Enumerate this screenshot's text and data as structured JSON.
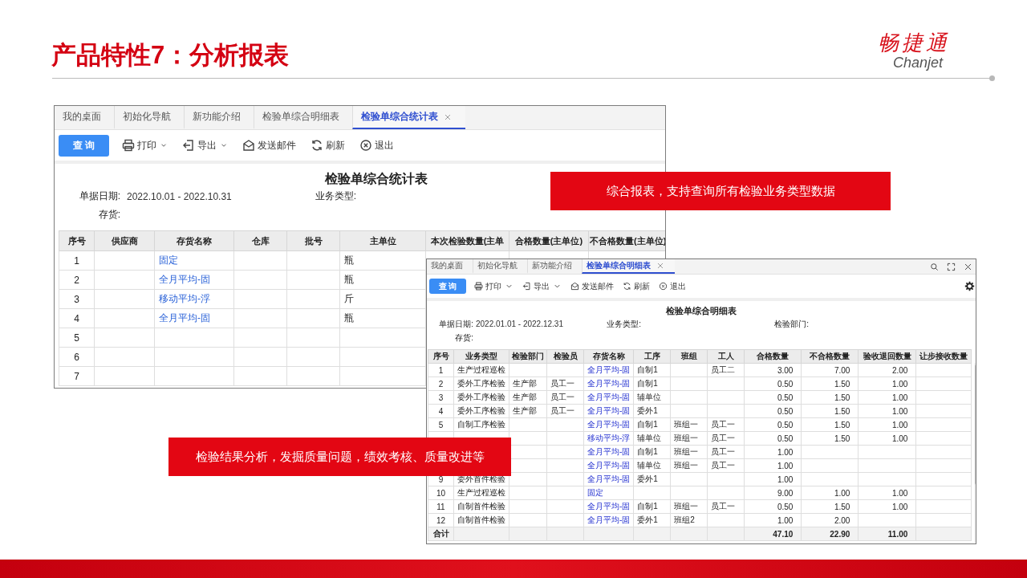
{
  "slide": {
    "title": "产品特性7：分析报表",
    "logo": {
      "brand": "畅捷通",
      "wordmark": "Chanjet"
    }
  },
  "summary_window": {
    "tabs": [
      {
        "label": "我的桌面",
        "selected": false,
        "closable": false
      },
      {
        "label": "初始化导航",
        "selected": false,
        "closable": false
      },
      {
        "label": "新功能介绍",
        "selected": false,
        "closable": false
      },
      {
        "label": "检验单综合明细表",
        "selected": false,
        "closable": false
      },
      {
        "label": "检验单综合统计表",
        "selected": true,
        "closable": true
      }
    ],
    "toolbar": [
      {
        "label": "查 询",
        "kind": "primary",
        "dropdown": false
      },
      {
        "label": "打印",
        "kind": "print",
        "dropdown": true
      },
      {
        "label": "导出",
        "kind": "export",
        "dropdown": true
      },
      {
        "label": "发送邮件",
        "kind": "mail",
        "dropdown": false
      },
      {
        "label": "刷新",
        "kind": "refresh",
        "dropdown": false
      },
      {
        "label": "退出",
        "kind": "exit",
        "dropdown": false
      }
    ],
    "report_title": "检验单综合统计表",
    "filters": [
      [
        {
          "label": "单据日期:",
          "value": "2022.10.01 - 2022.10.31"
        },
        {
          "label": "业务类型:"
        }
      ],
      [
        {
          "label": "存货:"
        }
      ]
    ],
    "table": {
      "columns": [
        {
          "label": "序号",
          "kind": "seq"
        },
        {
          "label": "供应商",
          "kind": "text"
        },
        {
          "label": "存货名称",
          "kind": "link"
        },
        {
          "label": "仓库",
          "kind": "text"
        },
        {
          "label": "批号",
          "kind": "text"
        },
        {
          "label": "主单位",
          "kind": "text"
        },
        {
          "label": "本次检验数量(主单",
          "kind": "number"
        },
        {
          "label": "合格数量(主单位)",
          "kind": "number"
        },
        {
          "label": "不合格数量(主单位)",
          "kind": "number"
        }
      ],
      "rows": [
        {
          "kind": "data",
          "cells": [
            "1",
            "",
            "固定",
            "",
            "",
            "瓶",
            "",
            "",
            ""
          ]
        },
        {
          "kind": "data",
          "cells": [
            "2",
            "",
            "全月平均-固",
            "",
            "",
            "瓶",
            "",
            "",
            ""
          ]
        },
        {
          "kind": "data",
          "cells": [
            "3",
            "",
            "移动平均-浮",
            "",
            "",
            "斤",
            "",
            "",
            ""
          ]
        },
        {
          "kind": "data",
          "cells": [
            "4",
            "",
            "全月平均-固",
            "",
            "",
            "瓶",
            "",
            "",
            ""
          ]
        },
        {
          "kind": "data",
          "cells": [
            "5",
            "",
            "",
            "",
            "",
            "",
            "",
            "",
            ""
          ]
        },
        {
          "kind": "data",
          "cells": [
            "6",
            "",
            "",
            "",
            "",
            "",
            "",
            "",
            ""
          ]
        },
        {
          "kind": "data",
          "cells": [
            "7",
            "",
            "",
            "",
            "",
            "",
            "",
            "",
            ""
          ]
        }
      ]
    }
  },
  "detail_window": {
    "tabs": [
      {
        "label": "我的桌面",
        "selected": false,
        "closable": false
      },
      {
        "label": "初始化导航",
        "selected": false,
        "closable": false
      },
      {
        "label": "新功能介绍",
        "selected": false,
        "closable": false
      },
      {
        "label": "检验单综合明细表",
        "selected": true,
        "closable": true
      }
    ],
    "toolbar": [
      {
        "label": "查 询",
        "kind": "primary",
        "dropdown": false
      },
      {
        "label": "打印",
        "kind": "print",
        "dropdown": true
      },
      {
        "label": "导出",
        "kind": "export",
        "dropdown": true
      },
      {
        "label": "发送邮件",
        "kind": "mail",
        "dropdown": false
      },
      {
        "label": "刷新",
        "kind": "refresh",
        "dropdown": false
      },
      {
        "label": "退出",
        "kind": "exit",
        "dropdown": false
      }
    ],
    "report_title": "检验单综合明细表",
    "filters": [
      [
        {
          "label": "单据日期:",
          "value": "2022.01.01 - 2022.12.31"
        },
        {
          "label": "业务类型:"
        },
        {
          "label": "检验部门:"
        }
      ],
      [
        {
          "label": "存货:"
        }
      ]
    ],
    "table": {
      "columns": [
        {
          "label": "序号",
          "kind": "seq"
        },
        {
          "label": "业务类型",
          "kind": "text"
        },
        {
          "label": "检验部门",
          "kind": "text"
        },
        {
          "label": "检验员",
          "kind": "text"
        },
        {
          "label": "存货名称",
          "kind": "link"
        },
        {
          "label": "工序",
          "kind": "text"
        },
        {
          "label": "班组",
          "kind": "text"
        },
        {
          "label": "工人",
          "kind": "text"
        },
        {
          "label": "合格数量",
          "kind": "number"
        },
        {
          "label": "不合格数量",
          "kind": "number"
        },
        {
          "label": "验收退回数量",
          "kind": "number"
        },
        {
          "label": "让步接收数量",
          "kind": "number"
        }
      ],
      "rows": [
        {
          "kind": "data",
          "cells": [
            "1",
            "生产过程巡检",
            "",
            "",
            "全月平均-固",
            "自制1",
            "",
            "员工二",
            "3.00",
            "7.00",
            "2.00",
            ""
          ]
        },
        {
          "kind": "data",
          "cells": [
            "2",
            "委外工序检验",
            "生产部",
            "员工一",
            "全月平均-固",
            "自制1",
            "",
            "",
            "0.50",
            "1.50",
            "1.00",
            ""
          ]
        },
        {
          "kind": "data",
          "cells": [
            "3",
            "委外工序检验",
            "生产部",
            "员工一",
            "全月平均-固",
            "辅单位",
            "",
            "",
            "0.50",
            "1.50",
            "1.00",
            ""
          ]
        },
        {
          "kind": "data",
          "cells": [
            "4",
            "委外工序检验",
            "生产部",
            "员工一",
            "全月平均-固",
            "委外1",
            "",
            "",
            "0.50",
            "1.50",
            "1.00",
            ""
          ]
        },
        {
          "kind": "data",
          "cells": [
            "5",
            "自制工序检验",
            "",
            "",
            "全月平均-固",
            "自制1",
            "班组一",
            "员工一",
            "0.50",
            "1.50",
            "1.00",
            ""
          ]
        },
        {
          "kind": "data",
          "cells": [
            "",
            "",
            "",
            "",
            "移动平均-浮",
            "辅单位",
            "班组一",
            "员工一",
            "0.50",
            "1.50",
            "1.00",
            ""
          ]
        },
        {
          "kind": "data",
          "cells": [
            "",
            "",
            "",
            "",
            "全月平均-固",
            "自制1",
            "班组一",
            "员工一",
            "1.00",
            "",
            "",
            ""
          ]
        },
        {
          "kind": "data",
          "cells": [
            "",
            "",
            "",
            "",
            "全月平均-固",
            "辅单位",
            "班组一",
            "员工一",
            "1.00",
            "",
            "",
            ""
          ]
        },
        {
          "kind": "data",
          "cells": [
            "9",
            "委外首件检验",
            "",
            "",
            "全月平均-固",
            "委外1",
            "",
            "",
            "1.00",
            "",
            "",
            ""
          ]
        },
        {
          "kind": "data",
          "cells": [
            "10",
            "生产过程巡检",
            "",
            "",
            "固定",
            "",
            "",
            "",
            "9.00",
            "1.00",
            "1.00",
            ""
          ]
        },
        {
          "kind": "data",
          "cells": [
            "11",
            "自制首件检验",
            "",
            "",
            "全月平均-固",
            "自制1",
            "班组一",
            "员工一",
            "0.50",
            "1.50",
            "1.00",
            ""
          ]
        },
        {
          "kind": "data",
          "cells": [
            "12",
            "自制首件检验",
            "",
            "",
            "全月平均-固",
            "委外1",
            "班组2",
            "",
            "1.00",
            "2.00",
            "",
            ""
          ]
        },
        {
          "kind": "total",
          "cells": [
            "合计",
            "",
            "",
            "",
            "",
            "",
            "",
            "",
            "47.10",
            "22.90",
            "11.00",
            ""
          ]
        }
      ]
    }
  },
  "callouts": [
    {
      "text": "综合报表，支持查询所有检验业务类型数据"
    },
    {
      "text": "检验结果分析，发掘质量问题，绩效考核、质量改进等"
    }
  ]
}
